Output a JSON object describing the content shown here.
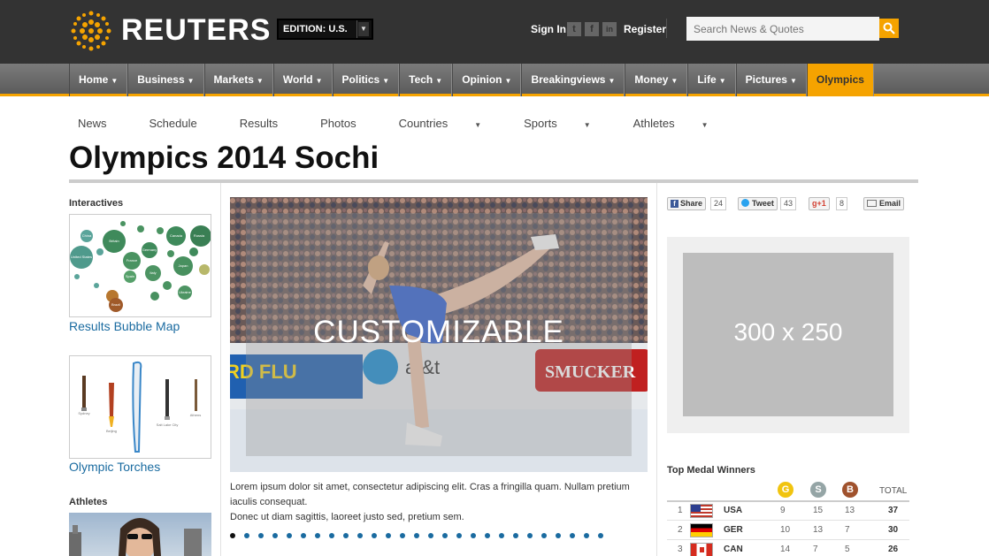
{
  "header": {
    "logo_text": "REUTERS",
    "edition_label": "EDITION: U.S.",
    "sign_in": "Sign In",
    "register": "Register",
    "search_placeholder": "Search News & Quotes",
    "social": [
      "t",
      "f",
      "in"
    ],
    "accent_color": "#f5a300"
  },
  "nav": {
    "items": [
      {
        "label": "Home",
        "caret": "▼"
      },
      {
        "label": "Business",
        "caret": "▼"
      },
      {
        "label": "Markets",
        "caret": "▼"
      },
      {
        "label": "World",
        "caret": "▼"
      },
      {
        "label": "Politics",
        "caret": "▼"
      },
      {
        "label": "Tech",
        "caret": "▼"
      },
      {
        "label": "Opinion",
        "caret": "▼"
      },
      {
        "label": "Breakingviews",
        "caret": "▼"
      },
      {
        "label": "Money",
        "caret": "▼"
      },
      {
        "label": "Life",
        "caret": "▼"
      },
      {
        "label": "Pictures",
        "caret": "▼"
      },
      {
        "label": "Olympics",
        "caret": ""
      }
    ]
  },
  "subnav": {
    "items": [
      {
        "label": "News",
        "caret": ""
      },
      {
        "label": "Schedule",
        "caret": ""
      },
      {
        "label": "Results",
        "caret": ""
      },
      {
        "label": "Photos",
        "caret": ""
      },
      {
        "label": "Countries",
        "caret": "▼"
      },
      {
        "label": "Sports",
        "caret": "▼"
      },
      {
        "label": "Athletes",
        "caret": "▼"
      }
    ]
  },
  "page_title": "Olympics 2014 Sochi",
  "left": {
    "interactives_heading": "Interactives",
    "bubble_map_link": "Results Bubble Map",
    "bubble_labels": [
      "Russia",
      "Britain",
      "Germany",
      "Canada",
      "France",
      "United States",
      "Japan",
      "Italy",
      "Spain",
      "Brazil",
      "Ukraine",
      "China"
    ],
    "torches_link": "Olympic Torches",
    "torch_labels": [
      "Sydney",
      "Beijing",
      "Salt Lake City",
      "Athens"
    ],
    "athletes_heading": "Athletes"
  },
  "hero": {
    "overlay_label": "CUSTOMIZABLE",
    "sponsor_left": "RD FLU",
    "sponsor_mid": "at&t",
    "sponsor_right": "SMUCKER"
  },
  "caption": {
    "line1": "Lorem ipsum dolor sit amet, consectetur adipiscing elit. Cras a fringilla quam. Nullam pretium iaculis consequat.",
    "line2": "Donec ut diam sagittis, laoreet justo sed, pretium sem."
  },
  "slider": {
    "total_dots": 27,
    "active_index": 0
  },
  "share": {
    "facebook": {
      "label": "Share",
      "count": "24"
    },
    "twitter": {
      "label": "Tweet",
      "count": "43"
    },
    "google": {
      "label": "+1",
      "count": "8"
    },
    "email": {
      "label": "Email"
    }
  },
  "ad": {
    "label": "300 x 250"
  },
  "medals": {
    "heading": "Top Medal Winners",
    "gold_letter": "G",
    "silver_letter": "S",
    "bronze_letter": "B",
    "total_label": "TOTAL",
    "colors": {
      "gold": "#f1c40f",
      "silver": "#95a5a6",
      "bronze": "#a0522d"
    },
    "rows": [
      {
        "rank": "1",
        "country": "USA",
        "gold": "9",
        "silver": "15",
        "bronze": "13",
        "total": "37"
      },
      {
        "rank": "2",
        "country": "GER",
        "gold": "10",
        "silver": "13",
        "bronze": "7",
        "total": "30"
      },
      {
        "rank": "3",
        "country": "CAN",
        "gold": "14",
        "silver": "7",
        "bronze": "5",
        "total": "26"
      }
    ]
  }
}
